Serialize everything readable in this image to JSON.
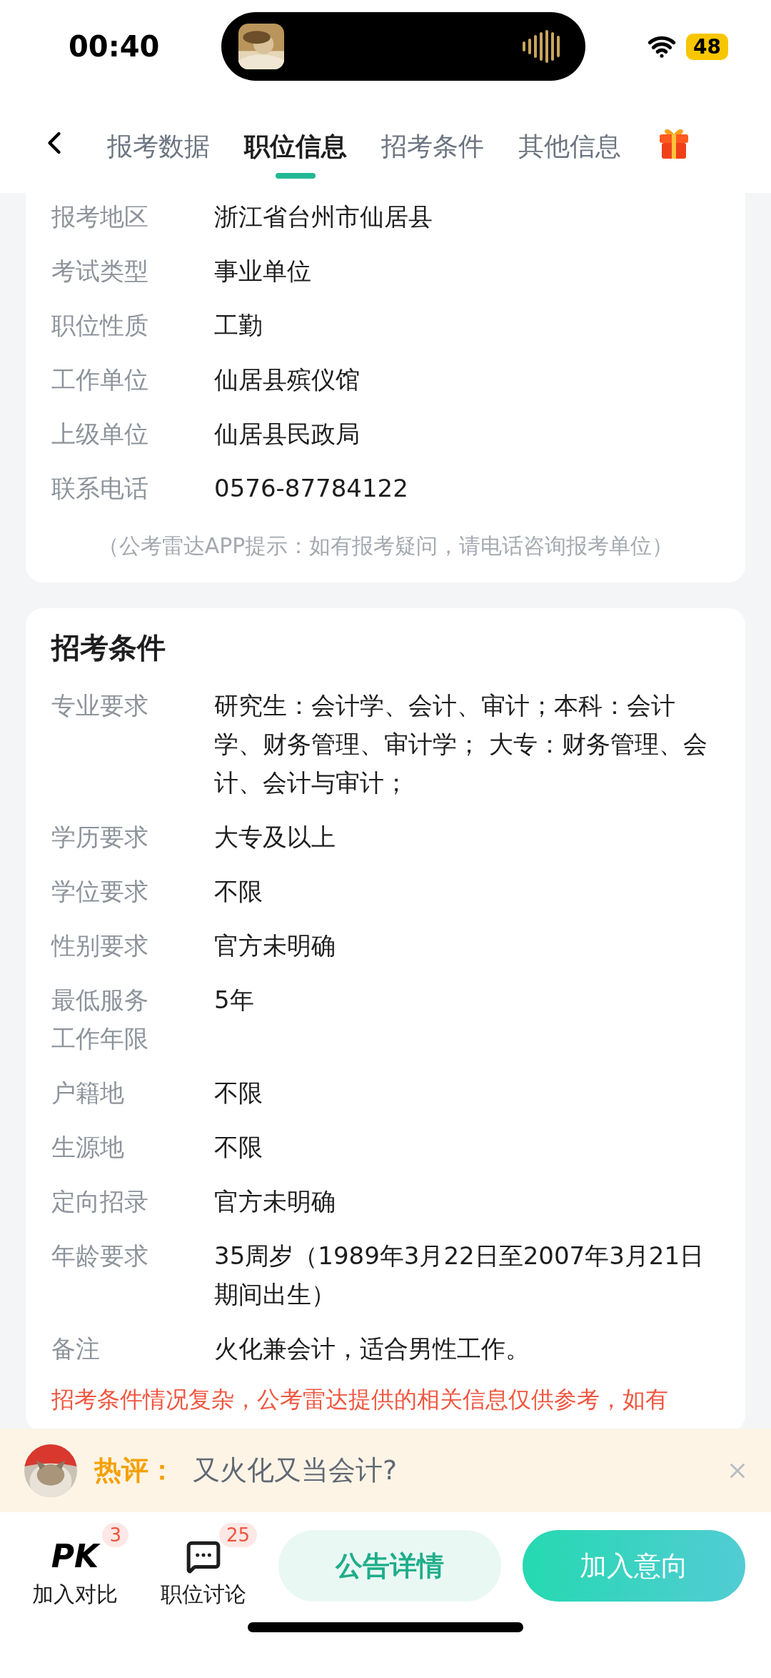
{
  "status_bar": {
    "time": "00:40",
    "battery": "48"
  },
  "tabs": [
    {
      "label": "报考数据",
      "selected": false
    },
    {
      "label": "职位信息",
      "selected": true
    },
    {
      "label": "招考条件",
      "selected": false
    },
    {
      "label": "其他信息",
      "selected": false
    }
  ],
  "position_info": {
    "rows": [
      {
        "label": "报考地区",
        "value": "浙江省台州市仙居县"
      },
      {
        "label": "考试类型",
        "value": "事业单位"
      },
      {
        "label": "职位性质",
        "value": "工勤"
      },
      {
        "label": "工作单位",
        "value": "仙居县殡仪馆"
      },
      {
        "label": "上级单位",
        "value": "仙居县民政局"
      },
      {
        "label": "联系电话",
        "value": "0576-87784122"
      }
    ],
    "note": "（公考雷达APP提示：如有报考疑问，请电话咨询报考单位）"
  },
  "conditions": {
    "title": "招考条件",
    "rows": [
      {
        "label": "专业要求",
        "value": "研究生：会计学、会计、审计；本科：会计学、财务管理、审计学； 大专：财务管理、会计、会计与审计；"
      },
      {
        "label": "学历要求",
        "value": "大专及以上"
      },
      {
        "label": "学位要求",
        "value": "不限"
      },
      {
        "label": "性别要求",
        "value": "官方未明确"
      },
      {
        "label": "最低服务工作年限",
        "value": "5年"
      },
      {
        "label": "户籍地",
        "value": "不限"
      },
      {
        "label": "生源地",
        "value": "不限"
      },
      {
        "label": "定向招录",
        "value": "官方未明确"
      },
      {
        "label": "年龄要求",
        "value": "35周岁（1989年3月22日至2007年3月21日期间出生）"
      },
      {
        "label": "备注",
        "value": "火化兼会计，适合男性工作。"
      }
    ],
    "warning": "招考条件情况复杂，公考雷达提供的相关信息仅供参考，如有"
  },
  "hot_comment": {
    "label": "热评：",
    "text": "又火化又当会计?"
  },
  "bottom_bar": {
    "actions": [
      {
        "kind": "pk",
        "icon_text": "PK",
        "label": "加入对比",
        "badge": "3"
      },
      {
        "kind": "chat",
        "label": "职位讨论",
        "badge": "25"
      }
    ],
    "buttons": [
      {
        "kind": "secondary",
        "label": "公告详情"
      },
      {
        "kind": "primary",
        "label": "加入意向"
      }
    ]
  }
}
